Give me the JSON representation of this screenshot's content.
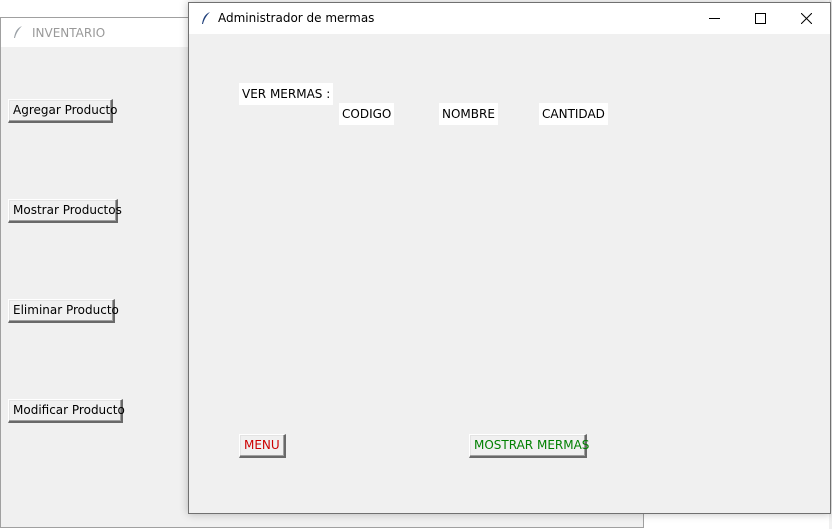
{
  "background_window": {
    "title": "INVENTARIO",
    "buttons": {
      "add": "Agregar Producto",
      "show": "Mostrar Productos",
      "delete": "Eliminar Producto",
      "modify": "Modificar Producto"
    }
  },
  "main_window": {
    "title": "Administrador de mermas",
    "labels": {
      "view": "VER MERMAS :",
      "code": "CODIGO",
      "name": "NOMBRE",
      "quantity": "CANTIDAD"
    },
    "buttons": {
      "menu": "MENU",
      "show": "MOSTRAR MERMAS"
    }
  },
  "colors": {
    "menu_text": "#cc0000",
    "show_text": "#008000"
  }
}
